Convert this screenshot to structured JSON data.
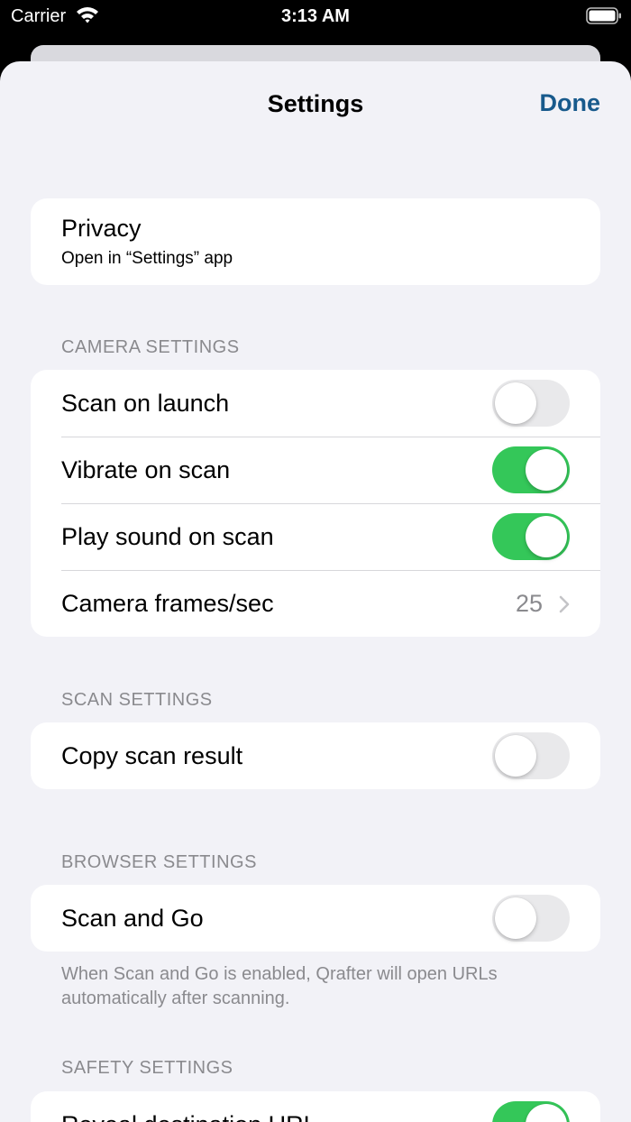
{
  "status_bar": {
    "carrier": "Carrier",
    "time": "3:13 AM"
  },
  "nav": {
    "title": "Settings",
    "done": "Done"
  },
  "privacy": {
    "title": "Privacy",
    "subtitle": "Open in “Settings” app"
  },
  "camera": {
    "header": "CAMERA SETTINGS",
    "scan_on_launch": {
      "label": "Scan on launch",
      "on": false
    },
    "vibrate_on_scan": {
      "label": "Vibrate on scan",
      "on": true
    },
    "play_sound_on_scan": {
      "label": "Play sound on scan",
      "on": true
    },
    "frames": {
      "label": "Camera frames/sec",
      "value": "25"
    }
  },
  "scan": {
    "header": "SCAN SETTINGS",
    "copy_scan_result": {
      "label": "Copy scan result",
      "on": false
    }
  },
  "browser": {
    "header": "BROWSER SETTINGS",
    "scan_and_go": {
      "label": "Scan and Go",
      "on": false
    },
    "footer": "When Scan and Go is enabled, Qrafter will open URLs automatically after scanning."
  },
  "safety": {
    "header": "SAFETY SETTINGS",
    "reveal_destination_url": {
      "label": "Reveal destination URL",
      "on": true
    }
  },
  "colors": {
    "accent": "#185a8c",
    "toggle_on": "#34c759",
    "toggle_off": "#e9e9eb",
    "background": "#f2f2f7"
  }
}
